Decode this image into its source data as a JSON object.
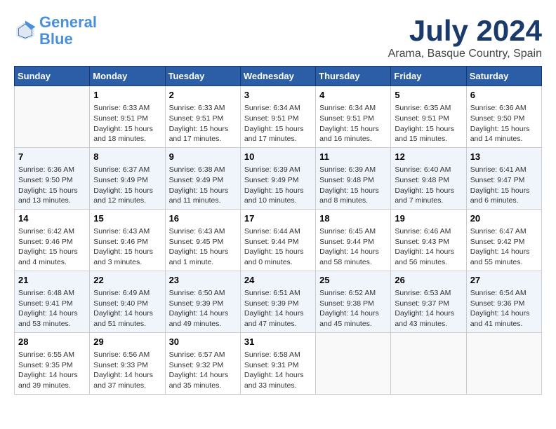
{
  "header": {
    "logo_line1": "General",
    "logo_line2": "Blue",
    "title": "July 2024",
    "subtitle": "Arama, Basque Country, Spain"
  },
  "calendar": {
    "columns": [
      "Sunday",
      "Monday",
      "Tuesday",
      "Wednesday",
      "Thursday",
      "Friday",
      "Saturday"
    ],
    "weeks": [
      [
        {
          "day": "",
          "info": ""
        },
        {
          "day": "1",
          "info": "Sunrise: 6:33 AM\nSunset: 9:51 PM\nDaylight: 15 hours\nand 18 minutes."
        },
        {
          "day": "2",
          "info": "Sunrise: 6:33 AM\nSunset: 9:51 PM\nDaylight: 15 hours\nand 17 minutes."
        },
        {
          "day": "3",
          "info": "Sunrise: 6:34 AM\nSunset: 9:51 PM\nDaylight: 15 hours\nand 17 minutes."
        },
        {
          "day": "4",
          "info": "Sunrise: 6:34 AM\nSunset: 9:51 PM\nDaylight: 15 hours\nand 16 minutes."
        },
        {
          "day": "5",
          "info": "Sunrise: 6:35 AM\nSunset: 9:51 PM\nDaylight: 15 hours\nand 15 minutes."
        },
        {
          "day": "6",
          "info": "Sunrise: 6:36 AM\nSunset: 9:50 PM\nDaylight: 15 hours\nand 14 minutes."
        }
      ],
      [
        {
          "day": "7",
          "info": "Sunrise: 6:36 AM\nSunset: 9:50 PM\nDaylight: 15 hours\nand 13 minutes."
        },
        {
          "day": "8",
          "info": "Sunrise: 6:37 AM\nSunset: 9:49 PM\nDaylight: 15 hours\nand 12 minutes."
        },
        {
          "day": "9",
          "info": "Sunrise: 6:38 AM\nSunset: 9:49 PM\nDaylight: 15 hours\nand 11 minutes."
        },
        {
          "day": "10",
          "info": "Sunrise: 6:39 AM\nSunset: 9:49 PM\nDaylight: 15 hours\nand 10 minutes."
        },
        {
          "day": "11",
          "info": "Sunrise: 6:39 AM\nSunset: 9:48 PM\nDaylight: 15 hours\nand 8 minutes."
        },
        {
          "day": "12",
          "info": "Sunrise: 6:40 AM\nSunset: 9:48 PM\nDaylight: 15 hours\nand 7 minutes."
        },
        {
          "day": "13",
          "info": "Sunrise: 6:41 AM\nSunset: 9:47 PM\nDaylight: 15 hours\nand 6 minutes."
        }
      ],
      [
        {
          "day": "14",
          "info": "Sunrise: 6:42 AM\nSunset: 9:46 PM\nDaylight: 15 hours\nand 4 minutes."
        },
        {
          "day": "15",
          "info": "Sunrise: 6:43 AM\nSunset: 9:46 PM\nDaylight: 15 hours\nand 3 minutes."
        },
        {
          "day": "16",
          "info": "Sunrise: 6:43 AM\nSunset: 9:45 PM\nDaylight: 15 hours\nand 1 minute."
        },
        {
          "day": "17",
          "info": "Sunrise: 6:44 AM\nSunset: 9:44 PM\nDaylight: 15 hours\nand 0 minutes."
        },
        {
          "day": "18",
          "info": "Sunrise: 6:45 AM\nSunset: 9:44 PM\nDaylight: 14 hours\nand 58 minutes."
        },
        {
          "day": "19",
          "info": "Sunrise: 6:46 AM\nSunset: 9:43 PM\nDaylight: 14 hours\nand 56 minutes."
        },
        {
          "day": "20",
          "info": "Sunrise: 6:47 AM\nSunset: 9:42 PM\nDaylight: 14 hours\nand 55 minutes."
        }
      ],
      [
        {
          "day": "21",
          "info": "Sunrise: 6:48 AM\nSunset: 9:41 PM\nDaylight: 14 hours\nand 53 minutes."
        },
        {
          "day": "22",
          "info": "Sunrise: 6:49 AM\nSunset: 9:40 PM\nDaylight: 14 hours\nand 51 minutes."
        },
        {
          "day": "23",
          "info": "Sunrise: 6:50 AM\nSunset: 9:39 PM\nDaylight: 14 hours\nand 49 minutes."
        },
        {
          "day": "24",
          "info": "Sunrise: 6:51 AM\nSunset: 9:39 PM\nDaylight: 14 hours\nand 47 minutes."
        },
        {
          "day": "25",
          "info": "Sunrise: 6:52 AM\nSunset: 9:38 PM\nDaylight: 14 hours\nand 45 minutes."
        },
        {
          "day": "26",
          "info": "Sunrise: 6:53 AM\nSunset: 9:37 PM\nDaylight: 14 hours\nand 43 minutes."
        },
        {
          "day": "27",
          "info": "Sunrise: 6:54 AM\nSunset: 9:36 PM\nDaylight: 14 hours\nand 41 minutes."
        }
      ],
      [
        {
          "day": "28",
          "info": "Sunrise: 6:55 AM\nSunset: 9:35 PM\nDaylight: 14 hours\nand 39 minutes."
        },
        {
          "day": "29",
          "info": "Sunrise: 6:56 AM\nSunset: 9:33 PM\nDaylight: 14 hours\nand 37 minutes."
        },
        {
          "day": "30",
          "info": "Sunrise: 6:57 AM\nSunset: 9:32 PM\nDaylight: 14 hours\nand 35 minutes."
        },
        {
          "day": "31",
          "info": "Sunrise: 6:58 AM\nSunset: 9:31 PM\nDaylight: 14 hours\nand 33 minutes."
        },
        {
          "day": "",
          "info": ""
        },
        {
          "day": "",
          "info": ""
        },
        {
          "day": "",
          "info": ""
        }
      ]
    ]
  }
}
